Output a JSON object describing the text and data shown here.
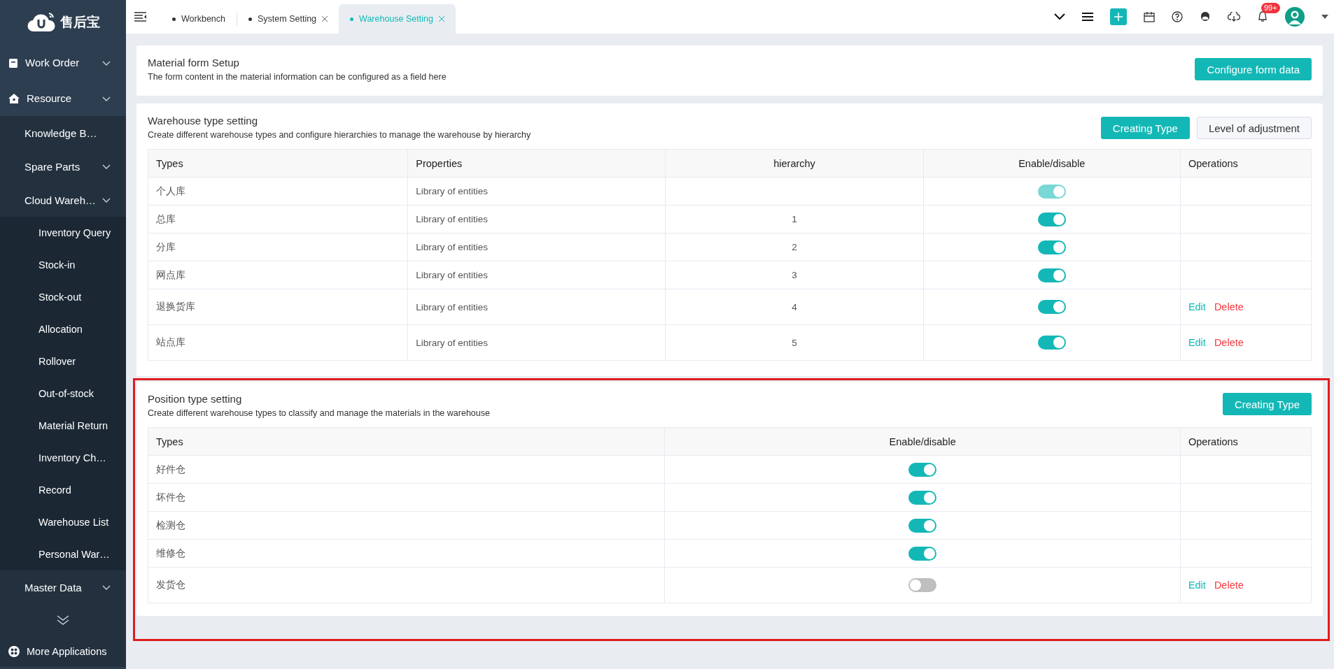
{
  "logo": {
    "text": "售后宝"
  },
  "sidebar": {
    "items": [
      {
        "label": "Work Order",
        "expandable": true
      },
      {
        "label": "Resource",
        "expandable": true,
        "children": [
          {
            "label": "Knowledge B…",
            "expandable": false
          },
          {
            "label": "Spare Parts",
            "expandable": true
          },
          {
            "label": "Cloud Wareh…",
            "expandable": true,
            "children": [
              {
                "label": "Inventory Query"
              },
              {
                "label": "Stock-in"
              },
              {
                "label": "Stock-out"
              },
              {
                "label": "Allocation"
              },
              {
                "label": "Rollover"
              },
              {
                "label": "Out-of-stock"
              },
              {
                "label": "Material Return"
              },
              {
                "label": "Inventory Ch…"
              },
              {
                "label": "Record"
              },
              {
                "label": "Warehouse List"
              },
              {
                "label": "Personal War…"
              }
            ]
          },
          {
            "label": "Master Data",
            "expandable": true
          }
        ]
      }
    ],
    "more_applications": "More Applications"
  },
  "tabs": [
    {
      "label": "Workbench",
      "selected": false,
      "closable": false
    },
    {
      "label": "System Setting",
      "selected": false,
      "closable": true
    },
    {
      "label": "Warehouse Setting",
      "selected": true,
      "closable": true
    }
  ],
  "notifications": {
    "badge": "99+"
  },
  "material_form": {
    "title": "Material form Setup",
    "description": "The form content in the material information can be configured as a field here",
    "button": "Configure form data"
  },
  "warehouse_types": {
    "title": "Warehouse type setting",
    "description": "Create different warehouse types and configure hierarchies to manage the warehouse by hierarchy",
    "buttons": [
      {
        "label": "Creating Type",
        "kind": "primary"
      },
      {
        "label": "Level of adjustment",
        "kind": "default"
      }
    ],
    "columns": [
      "Types",
      "Properties",
      "hierarchy",
      "Enable/disable",
      "Operations"
    ],
    "rows": [
      {
        "type": "个人库",
        "property": "Library of entities",
        "on": true,
        "disabled": true
      },
      {
        "type": "总库",
        "property": "Library of entities",
        "hierarchy": "1",
        "on": true,
        "disabled": false
      },
      {
        "type": "分库",
        "property": "Library of entities",
        "hierarchy": "2",
        "on": true,
        "disabled": false
      },
      {
        "type": "网点库",
        "property": "Library of entities",
        "hierarchy": "3",
        "on": true,
        "disabled": false
      },
      {
        "type": "退换货库",
        "property": "Library of entities",
        "hierarchy": "4",
        "on": true,
        "disabled": false,
        "actions": [
          {
            "label": "Edit",
            "kind": "edit"
          },
          {
            "label": "Delete",
            "kind": "delete"
          }
        ]
      },
      {
        "type": "站点库",
        "property": "Library of entities",
        "hierarchy": "5",
        "on": true,
        "disabled": false,
        "actions": [
          {
            "label": "Edit",
            "kind": "edit"
          },
          {
            "label": "Delete",
            "kind": "delete"
          }
        ]
      }
    ]
  },
  "position_types": {
    "title": "Position type setting",
    "description": "Create different warehouse types to classify and manage the materials in the warehouse",
    "buttons": [
      {
        "label": "Creating Type",
        "kind": "primary"
      }
    ],
    "columns": [
      "Types",
      "Enable/disable",
      "Operations"
    ],
    "rows": [
      {
        "type": "好件仓",
        "on": true
      },
      {
        "type": "坏件仓",
        "on": true
      },
      {
        "type": "检测仓",
        "on": true
      },
      {
        "type": "维修仓",
        "on": true
      },
      {
        "type": "发货仓",
        "on": false,
        "actions": [
          {
            "label": "Edit",
            "kind": "edit"
          },
          {
            "label": "Delete",
            "kind": "delete"
          }
        ]
      }
    ]
  }
}
